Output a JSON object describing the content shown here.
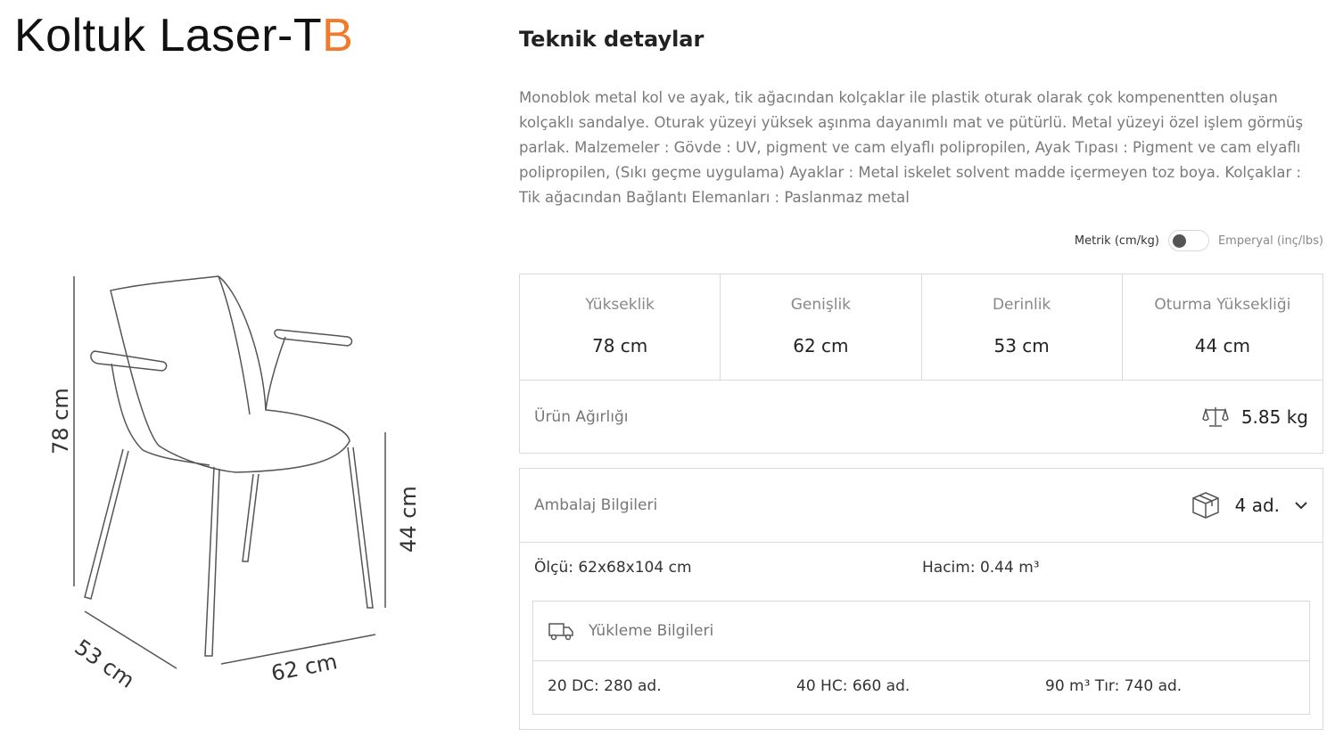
{
  "product": {
    "title_main": "Koltuk Laser-T",
    "title_accent": "B"
  },
  "dimensions_drawing": {
    "height": "78 cm",
    "seat_height": "44 cm",
    "depth": "53 cm",
    "width": "62 cm"
  },
  "details": {
    "title": "Teknik detaylar",
    "description": "Monoblok metal kol ve ayak, tik ağacından kolçaklar ile plastik oturak olarak çok kompenentten oluşan kolçaklı sandalye. Oturak yüzeyi yüksek aşınma dayanımlı mat ve pütürlü. Metal yüzeyi özel işlem görmüş parlak. Malzemeler : Gövde : UV, pigment ve cam elyaflı polipropilen, Ayak Tıpası : Pigment ve cam elyaflı polipropilen, (Sıkı geçme uygulama) Ayaklar : Metal iskelet solvent madde içermeyen toz boya. Kolçaklar : Tik ağacından Bağlantı Elemanları : Paslanmaz metal"
  },
  "unit_toggle": {
    "metric_label": "Metrik (cm/kg)",
    "imperial_label": "Emperyal (inç/lbs)",
    "selected": "metric"
  },
  "dims": [
    {
      "label": "Yükseklik",
      "value": "78 cm"
    },
    {
      "label": "Genişlik",
      "value": "62 cm"
    },
    {
      "label": "Derinlik",
      "value": "53 cm"
    },
    {
      "label": "Oturma Yüksekliği",
      "value": "44 cm"
    }
  ],
  "weight": {
    "label": "Ürün Ağırlığı",
    "value": "5.85 kg",
    "icon": "scale-icon"
  },
  "packaging": {
    "label": "Ambalaj Bilgileri",
    "value": "4 ad.",
    "icon": "box-icon",
    "measure": "Ölçü: 62x68x104 cm",
    "volume": "Hacim: 0.44 m³",
    "loading": {
      "label": "Yükleme Bilgileri",
      "icon": "truck-icon",
      "rows": [
        "20 DC: 280 ad.",
        "40 HC: 660 ad.",
        "90 m³ Tır: 740 ad."
      ]
    }
  }
}
